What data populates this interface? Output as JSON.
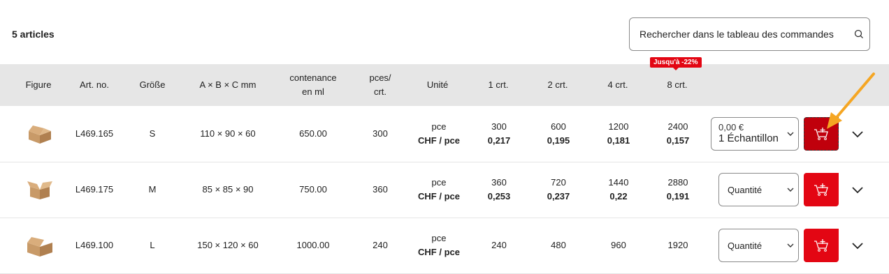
{
  "article_count": "5 articles",
  "search": {
    "placeholder": "Rechercher dans le tableau des commandes"
  },
  "discount_badge": "Jusqu'à -22%",
  "headers": {
    "figure": "Figure",
    "art_no": "Art. no.",
    "size": "Größe",
    "dims": "A × B × C mm",
    "capacity_1": "contenance",
    "capacity_2": "en ml",
    "pcs_1": "pces/",
    "pcs_2": "crt.",
    "unit": "Unité",
    "c1": "1 crt.",
    "c2": "2 crt.",
    "c4": "4 crt.",
    "c8": "8 crt."
  },
  "rows": [
    {
      "art": "L469.165",
      "size": "S",
      "dims": "110 × 90 × 60",
      "capacity": "650.00",
      "pcs": "300",
      "unit_top": "pce",
      "unit_bottom": "CHF / pce",
      "q1": "300",
      "p1": "0,217",
      "q2": "600",
      "p2": "0,195",
      "q4": "1200",
      "p4": "0,181",
      "q8": "2400",
      "p8": "0,157",
      "select_price": "0,00 €",
      "select_value": "1 Échantillon"
    },
    {
      "art": "L469.175",
      "size": "M",
      "dims": "85 × 85 × 90",
      "capacity": "750.00",
      "pcs": "360",
      "unit_top": "pce",
      "unit_bottom": "CHF / pce",
      "q1": "360",
      "p1": "0,253",
      "q2": "720",
      "p2": "0,237",
      "q4": "1440",
      "p4": "0,22",
      "q8": "2880",
      "p8": "0,191",
      "select_value": "Quantité"
    },
    {
      "art": "L469.100",
      "size": "L",
      "dims": "150 × 120 × 60",
      "capacity": "1000.00",
      "pcs": "240",
      "unit_top": "pce",
      "unit_bottom": "CHF / pce",
      "q1": "240",
      "p1": "",
      "q2": "480",
      "p2": "",
      "q4": "960",
      "p4": "",
      "q8": "1920",
      "p8": "",
      "select_value": "Quantité"
    }
  ],
  "colors": {
    "accent": "#e30613",
    "accent_active": "#c0000c",
    "header_bg": "#e6e6e6",
    "annotation_arrow": "#f5a623"
  }
}
